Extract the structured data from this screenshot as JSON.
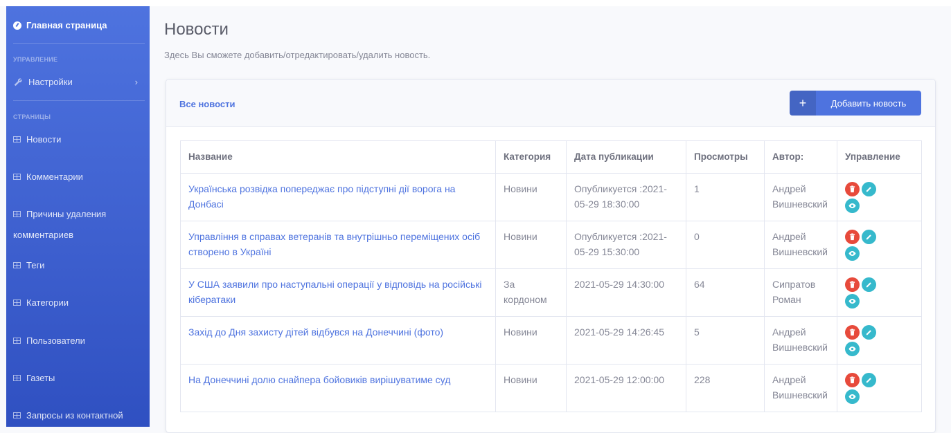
{
  "sidebar": {
    "brand": "Главная страница",
    "heading_manage": "УПРАВЛЕНИЕ",
    "settings": "Настройки",
    "heading_pages": "СТРАНИЦЫ",
    "items": [
      "Новости",
      "Комментарии",
      "Причины удаления",
      "комментариев",
      "Теги",
      "Категории",
      "Пользователи",
      "Газеты",
      "Запросы из контактной"
    ]
  },
  "page": {
    "title": "Новости",
    "subtitle": "Здесь Вы сможете добавить/отредактировать/удалить новость."
  },
  "card": {
    "title": "Все новости",
    "add_button": "Добавить новость"
  },
  "table": {
    "headers": [
      "Название",
      "Категория",
      "Дата публикации",
      "Просмотры",
      "Автор:",
      "Управление"
    ],
    "rows": [
      {
        "title": "Українська розвідка попереджає про підступні дії ворога на Донбасі",
        "category": "Новини",
        "date": "Опубликуется :2021-05-29 18:30:00",
        "views": "1",
        "author": "Андрей Вишневский"
      },
      {
        "title": "Управління в справах ветеранів та внутрішньо переміщених осіб створено в Україні",
        "category": "Новини",
        "date": "Опубликуется :2021-05-29 15:30:00",
        "views": "0",
        "author": "Андрей Вишневский"
      },
      {
        "title": "У США заявили про наступальні операції у відповідь на російські кібератаки",
        "category": "За кордоном",
        "date": "2021-05-29 14:30:00",
        "views": "64",
        "author": "Сипратов Роман"
      },
      {
        "title": "Захід до Дня захисту дітей відбувся на Донеччині (фото)",
        "category": "Новини",
        "date": "2021-05-29 14:26:45",
        "views": "5",
        "author": "Андрей Вишневский"
      },
      {
        "title": "На Донеччині долю снайпера бойовиків вирішуватиме суд",
        "category": "Новини",
        "date": "2021-05-29 12:00:00",
        "views": "228",
        "author": "Андрей Вишневский"
      }
    ]
  },
  "colors": {
    "primary": "#4e73df",
    "danger": "#e74a3b",
    "info": "#36b9cc"
  }
}
